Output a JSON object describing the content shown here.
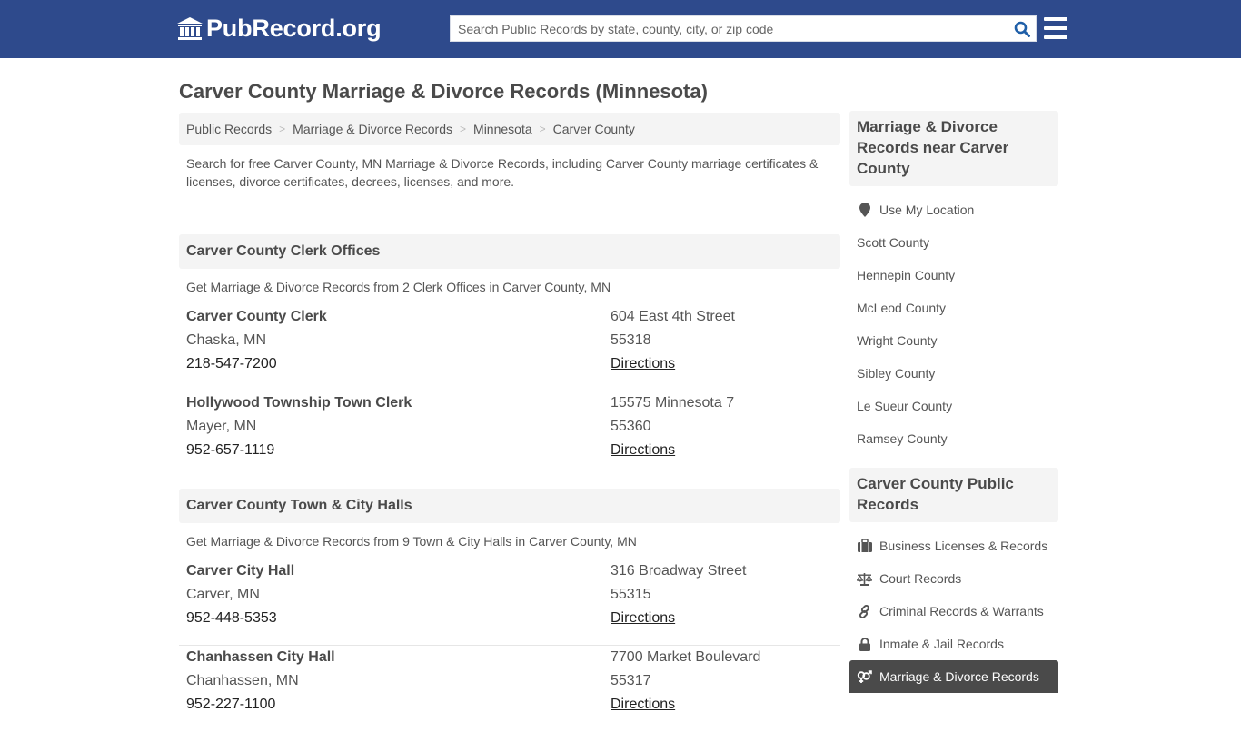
{
  "header": {
    "logo_text": "PubRecord.org",
    "search_placeholder": "Search Public Records by state, county, city, or zip code"
  },
  "page_title": "Carver County Marriage & Divorce Records (Minnesota)",
  "breadcrumb": [
    "Public Records",
    "Marriage & Divorce Records",
    "Minnesota",
    "Carver County"
  ],
  "intro": "Search for free Carver County, MN Marriage & Divorce Records, including Carver County marriage certificates & licenses, divorce certificates, decrees, licenses, and more.",
  "sections": [
    {
      "title": "Carver County Clerk Offices",
      "description": "Get Marriage & Divorce Records from 2 Clerk Offices in Carver County, MN",
      "entries": [
        {
          "name": "Carver County Clerk",
          "city": "Chaska, MN",
          "phone": "218-547-7200",
          "address": "604 East 4th Street",
          "zip": "55318",
          "directions": "Directions"
        },
        {
          "name": "Hollywood Township Town Clerk",
          "city": "Mayer, MN",
          "phone": "952-657-1119",
          "address": "15575 Minnesota 7",
          "zip": "55360",
          "directions": "Directions"
        }
      ]
    },
    {
      "title": "Carver County Town & City Halls",
      "description": "Get Marriage & Divorce Records from 9 Town & City Halls in Carver County, MN",
      "entries": [
        {
          "name": "Carver City Hall",
          "city": "Carver, MN",
          "phone": "952-448-5353",
          "address": "316 Broadway Street",
          "zip": "55315",
          "directions": "Directions"
        },
        {
          "name": "Chanhassen City Hall",
          "city": "Chanhassen, MN",
          "phone": "952-227-1100",
          "address": "7700 Market Boulevard",
          "zip": "55317",
          "directions": "Directions"
        }
      ]
    }
  ],
  "sidebar": {
    "nearby_title": "Marriage & Divorce Records near Carver County",
    "use_location": "Use My Location",
    "nearby": [
      "Scott County",
      "Hennepin County",
      "McLeod County",
      "Wright County",
      "Sibley County",
      "Le Sueur County",
      "Ramsey County"
    ],
    "public_title": "Carver County Public Records",
    "public_records": [
      {
        "label": "Business Licenses & Records",
        "icon": "briefcase-icon"
      },
      {
        "label": "Court Records",
        "icon": "scales-icon"
      },
      {
        "label": "Criminal Records & Warrants",
        "icon": "link-icon"
      },
      {
        "label": "Inmate & Jail Records",
        "icon": "lock-icon"
      },
      {
        "label": "Marriage & Divorce Records",
        "icon": "venus-mars-icon",
        "active": true
      }
    ]
  },
  "colors": {
    "header_bg": "#2e4a8c",
    "search_icon": "#1f5fa8",
    "active_item_bg": "#4a4a4a"
  }
}
